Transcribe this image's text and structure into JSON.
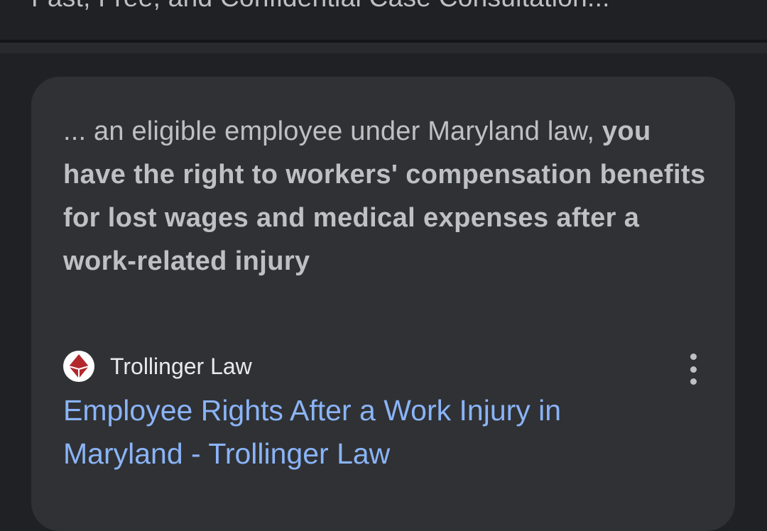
{
  "previous_result": {
    "snippet_tail": "Fast, Free, and Confidential Case Consultation..."
  },
  "featured_result": {
    "snippet_prefix": "... an eligible employee under Maryland law,",
    "snippet_bold": "you have the right to workers' compensation benefits for lost wages and medical expenses after a work-related injury",
    "source": {
      "name": "Trollinger Law",
      "favicon_icon": "trollinger-law-logo-icon"
    },
    "title": "Employee Rights After a Work Injury in Maryland - Trollinger Law",
    "more_icon": "more-vert-icon"
  },
  "colors": {
    "page_background": "#202124",
    "card_background": "#303134",
    "snippet_text": "#bdc1c6",
    "source_text": "#e8eaed",
    "link": "#8ab4f8",
    "logo_red": "#b3282d"
  }
}
